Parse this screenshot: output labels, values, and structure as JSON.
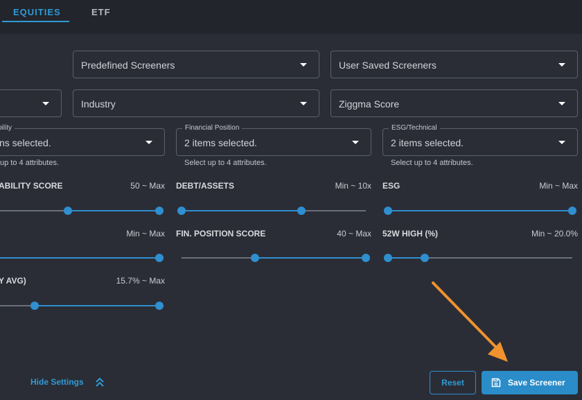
{
  "tabs": [
    {
      "label": "EQUITIES",
      "active": true
    },
    {
      "label": "ETF",
      "active": false
    }
  ],
  "dropdowns": {
    "predefined": "Predefined Screeners",
    "user_saved": "User Saved Screeners",
    "left_row2": "",
    "industry": "Industry",
    "ziggma_score": "Ziggma Score"
  },
  "attribute_selects": [
    {
      "legend": "bility",
      "value": "ns selected.",
      "helper": "up to 4 attributes."
    },
    {
      "legend": "Financial Position",
      "value": "2 items selected.",
      "helper": "Select up to 4 attributes."
    },
    {
      "legend": "ESG/Technical",
      "value": "2 items selected.",
      "helper": "Select up to 4 attributes."
    }
  ],
  "sliders": [
    {
      "title": "ABILITY SCORE",
      "range": "50 ~ Max",
      "low": 0.45,
      "high": 1.0
    },
    {
      "title": "DEBT/ASSETS",
      "range": "Min ~ 10x",
      "low": 0.0,
      "high": 0.65
    },
    {
      "title": "ESG",
      "range": "Min ~ Max",
      "low": 0.0,
      "high": 1.0
    },
    {
      "title": "",
      "range": "Min ~ Max",
      "low": 0.0,
      "high": 1.0
    },
    {
      "title": "FIN. POSITION SCORE",
      "range": "40 ~ Max",
      "low": 0.4,
      "high": 1.0
    },
    {
      "title": "52W HIGH (%)",
      "range": "Min ~ 20.0%",
      "low": 0.0,
      "high": 0.2
    },
    {
      "title": "Y AVG)",
      "range": "15.7% ~ Max",
      "low": 0.25,
      "high": 1.0
    }
  ],
  "footer": {
    "hide_settings": "Hide Settings",
    "reset": "Reset",
    "save": "Save Screener"
  },
  "colors": {
    "accent": "#2f8fcf",
    "annotation_arrow": "#f0922f",
    "background": "#2a2d36"
  },
  "icons": [
    "chevrons-up-icon",
    "save-icon",
    "caret-down-icon"
  ]
}
